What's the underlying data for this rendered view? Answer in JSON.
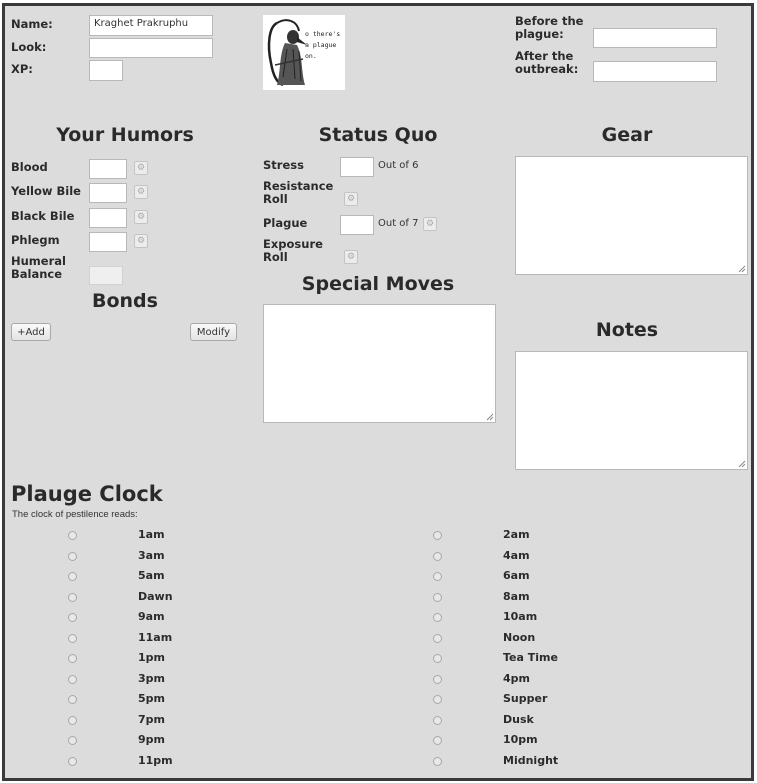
{
  "identity": {
    "name_label": "Name:",
    "name_value": "Kraghet Prakruphu",
    "look_label": "Look:",
    "xp_label": "XP:"
  },
  "logo": {
    "text": "o there's a plague on.",
    "icon": "plague-doctor-icon"
  },
  "history": {
    "before_label": "Before the plague:",
    "after_label": "After the outbreak:"
  },
  "humors": {
    "title": "Your Humors",
    "items": [
      {
        "label": "Blood"
      },
      {
        "label": "Yellow Bile"
      },
      {
        "label": "Black Bile"
      },
      {
        "label": "Phlegm"
      }
    ],
    "balance_label": "Humeral Balance"
  },
  "status": {
    "title": "Status Quo",
    "stress_label": "Stress",
    "stress_max": "Out of 6",
    "resistance_label": "Resistance Roll",
    "plague_label": "Plague",
    "plague_max": "Out of 7",
    "exposure_label": "Exposure Roll"
  },
  "gear": {
    "title": "Gear"
  },
  "special": {
    "title": "Special Moves"
  },
  "notes": {
    "title": "Notes"
  },
  "bonds": {
    "title": "Bonds",
    "add_label": "+Add",
    "modify_label": "Modify"
  },
  "clock": {
    "title": "Plauge Clock",
    "subtitle": "The clock of pestilence reads:",
    "left": [
      "1am",
      "3am",
      "5am",
      "Dawn",
      "9am",
      "11am",
      "1pm",
      "3pm",
      "5pm",
      "7pm",
      "9pm",
      "11pm"
    ],
    "right": [
      "2am",
      "4am",
      "6am",
      "8am",
      "10am",
      "Noon",
      "Tea Time",
      "4pm",
      "Supper",
      "Dusk",
      "10pm",
      "Midnight"
    ]
  }
}
